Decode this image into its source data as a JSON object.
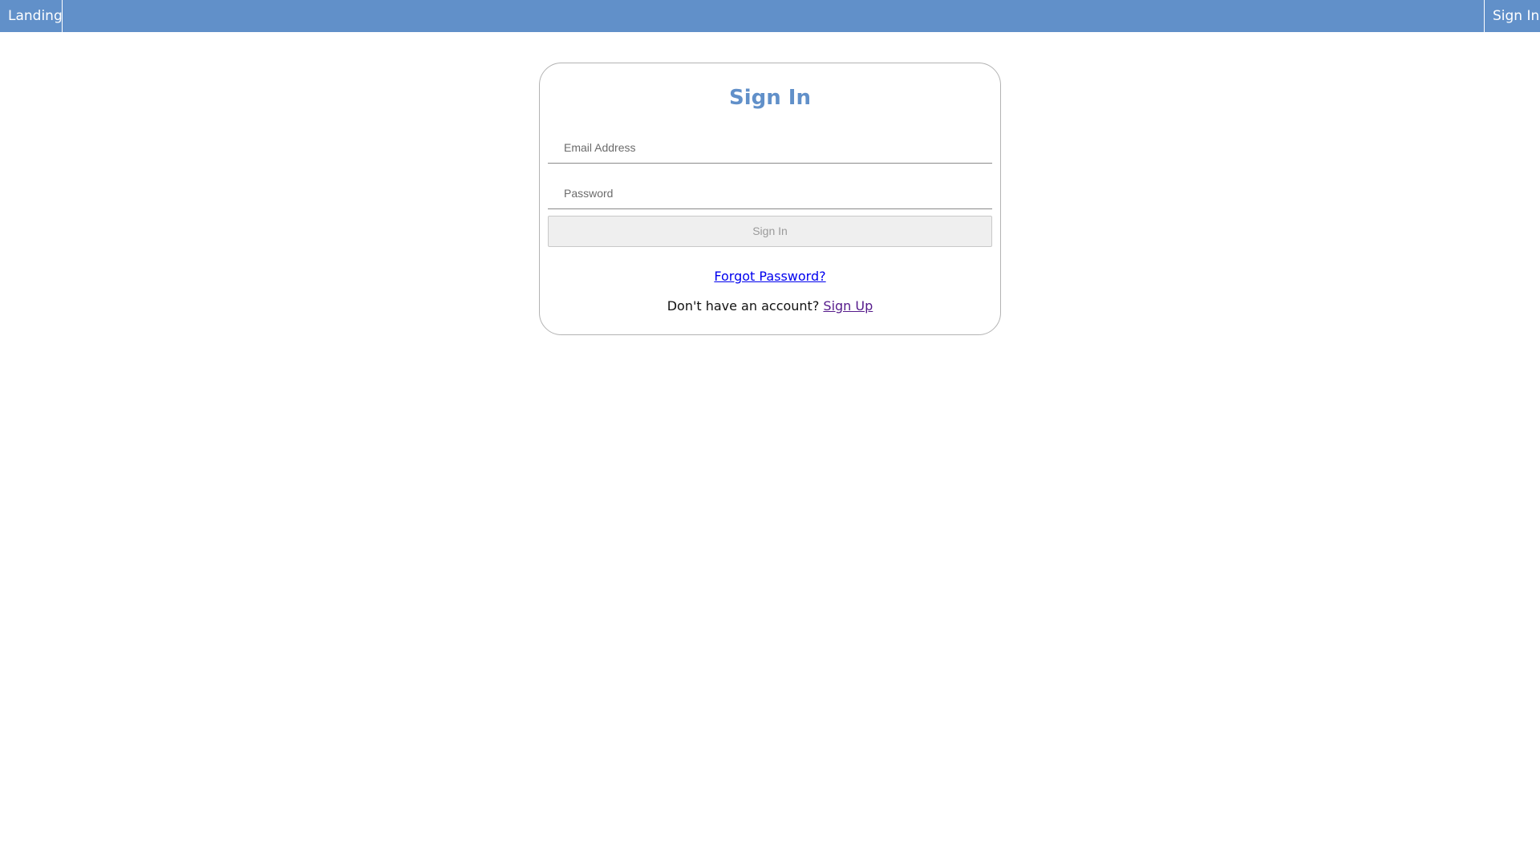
{
  "nav": {
    "left_label": "Landing",
    "right_label": "Sign In"
  },
  "signin": {
    "title": "Sign In",
    "email": {
      "value": "",
      "placeholder": "Email Address"
    },
    "password": {
      "value": "",
      "placeholder": "Password"
    },
    "submit_label": "Sign In",
    "forgot_label": "Forgot Password?",
    "signup_prompt": "Don't have an account?",
    "signup_label": "Sign Up"
  },
  "colors": {
    "brand": "#6190c9",
    "link": "#0000ee",
    "visited_link": "#551a8b"
  }
}
